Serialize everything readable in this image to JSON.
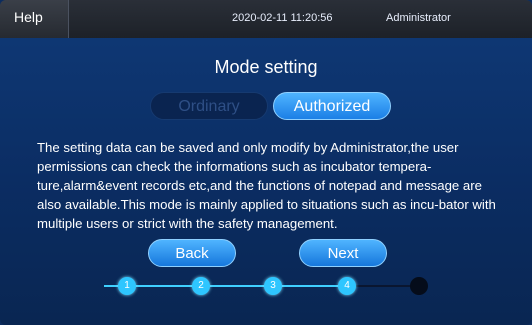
{
  "topbar": {
    "help_label": "Help",
    "datetime": "2020-02-11  11:20:56",
    "user": "Administrator"
  },
  "page": {
    "title": "Mode setting"
  },
  "modes": [
    {
      "label": "Ordinary",
      "selected": false
    },
    {
      "label": "Authorized",
      "selected": true
    }
  ],
  "description": "The setting data can be saved and only modify by Administrator,the user permissions can check the informations such as incubator tempera-ture,alarm&event records etc,and the functions of notepad and message are also available.This mode is mainly applied to situations such as incu-bator with multiple users or strict with the safety management.",
  "nav": {
    "back_label": "Back",
    "next_label": "Next"
  },
  "steps": {
    "labels": [
      "1",
      "2",
      "3",
      "4",
      ""
    ],
    "current": 5,
    "total": 5
  },
  "colors": {
    "accent": "#2ec6ff",
    "button": "#1b7fe6",
    "background": "#0f3a78"
  }
}
